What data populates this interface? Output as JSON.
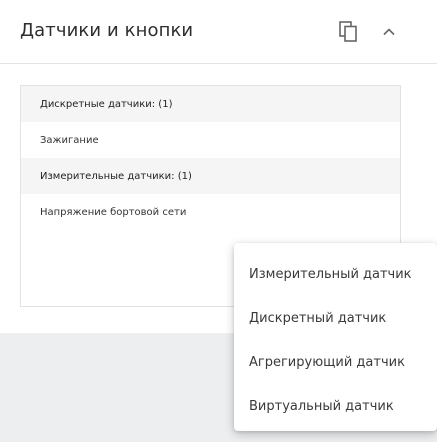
{
  "panel": {
    "title": "Датчики и кнопки"
  },
  "sensor_list": {
    "rows": [
      {
        "kind": "group",
        "label": "Дискретные датчики: (1)"
      },
      {
        "kind": "item",
        "label": "Зажигание"
      },
      {
        "kind": "group",
        "label": "Измерительные датчики: (1)"
      },
      {
        "kind": "item",
        "label": "Напряжение бортовой сети"
      }
    ]
  },
  "add_menu": {
    "items": [
      "Измерительный датчик",
      "Дискретный датчик",
      "Агрегирующий датчик",
      "Виртуальный датчик"
    ]
  },
  "icons": {
    "copy": "copy-icon",
    "collapse": "chevron-up-icon"
  },
  "colors": {
    "page_bg": "#eceef0",
    "group_row_bg": "#f5f5f5",
    "icon": "#666666"
  }
}
